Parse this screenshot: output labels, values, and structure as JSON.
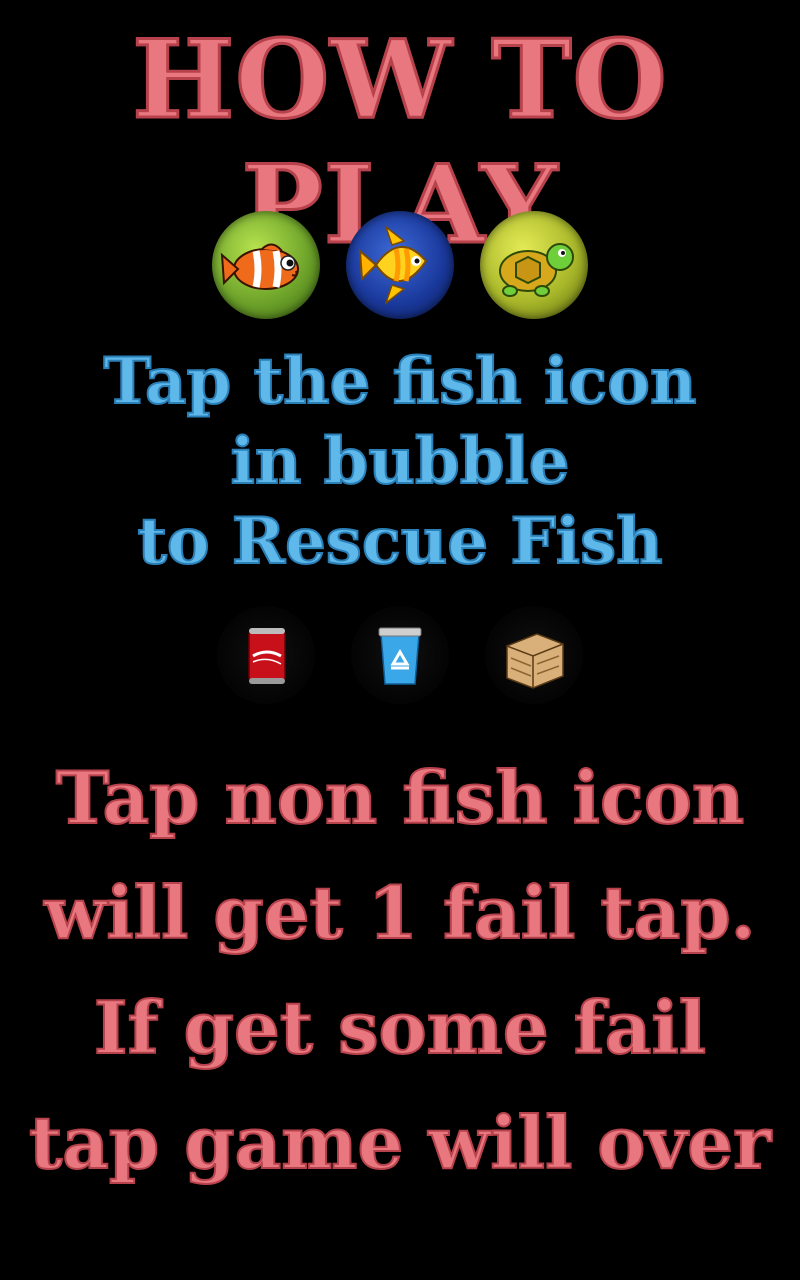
{
  "screen": {
    "title": "HOW TO PLAY",
    "fish_icons": [
      "clownfish-icon",
      "angelfish-icon",
      "turtle-icon"
    ],
    "instruction_lines": [
      "Tap the fish icon",
      "in bubble",
      "to Rescue Fish"
    ],
    "non_fish_icons": [
      "soda-can-icon",
      "recycle-bin-icon",
      "wooden-crate-icon"
    ],
    "warning_lines": [
      "Tap non fish icon",
      "will get 1 fail tap.",
      "If get some fail",
      "tap game will over"
    ],
    "colors": {
      "background": "#000000",
      "pink_text": "#e8777f",
      "blue_text": "#5fb8ea"
    }
  }
}
